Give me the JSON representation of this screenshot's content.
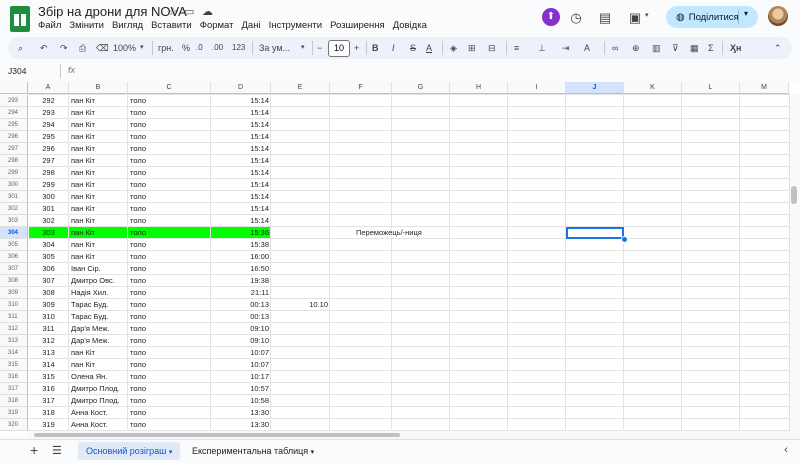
{
  "title": "Збір на дрони для NOVA",
  "menu": [
    "Файл",
    "Змінити",
    "Вигляд",
    "Вставити",
    "Формат",
    "Дані",
    "Інструменти",
    "Розширення",
    "Довідка"
  ],
  "share_label": "Поділитися",
  "toolbar": {
    "zoom": "100%",
    "currency": "грн.",
    "percent": "%",
    "dec_decrease": ".0",
    "dec_increase": ".00",
    "number_format": "123",
    "font": "За ум...",
    "font_size": "10"
  },
  "name_box": "J304",
  "fx_label": "fx",
  "formula_value": "",
  "columns": [
    "A",
    "B",
    "C",
    "D",
    "E",
    "F",
    "G",
    "H",
    "I",
    "J",
    "K",
    "L",
    "M"
  ],
  "selected_column": "J",
  "selected_row": "304",
  "rows": [
    {
      "n": "293",
      "a": "292",
      "b": "пан Кіт",
      "c": "толо",
      "d": "15:14",
      "e": "",
      "f": ""
    },
    {
      "n": "294",
      "a": "293",
      "b": "пан Кіт",
      "c": "толо",
      "d": "15:14",
      "e": "",
      "f": ""
    },
    {
      "n": "295",
      "a": "294",
      "b": "пан Кіт",
      "c": "толо",
      "d": "15:14",
      "e": "",
      "f": ""
    },
    {
      "n": "296",
      "a": "295",
      "b": "пан Кіт",
      "c": "толо",
      "d": "15:14",
      "e": "",
      "f": ""
    },
    {
      "n": "297",
      "a": "296",
      "b": "пан Кіт",
      "c": "толо",
      "d": "15:14",
      "e": "",
      "f": ""
    },
    {
      "n": "298",
      "a": "297",
      "b": "пан Кіт",
      "c": "толо",
      "d": "15:14",
      "e": "",
      "f": ""
    },
    {
      "n": "299",
      "a": "298",
      "b": "пан Кіт",
      "c": "толо",
      "d": "15:14",
      "e": "",
      "f": ""
    },
    {
      "n": "300",
      "a": "299",
      "b": "пан Кіт",
      "c": "толо",
      "d": "15:14",
      "e": "",
      "f": ""
    },
    {
      "n": "301",
      "a": "300",
      "b": "пан Кіт",
      "c": "толо",
      "d": "15:14",
      "e": "",
      "f": ""
    },
    {
      "n": "302",
      "a": "301",
      "b": "пан Кіт",
      "c": "толо",
      "d": "15:14",
      "e": "",
      "f": ""
    },
    {
      "n": "303",
      "a": "302",
      "b": "пан Кіт",
      "c": "толо",
      "d": "15:14",
      "e": "",
      "f": ""
    },
    {
      "n": "304",
      "a": "303",
      "b": "пан Кіт",
      "c": "толо",
      "d": "15:36",
      "e": "",
      "f": "Переможець/-ниця"
    },
    {
      "n": "305",
      "a": "304",
      "b": "пан Кіт",
      "c": "толо",
      "d": "15:38",
      "e": "",
      "f": ""
    },
    {
      "n": "306",
      "a": "305",
      "b": "пан Кіт",
      "c": "толо",
      "d": "16:00",
      "e": "",
      "f": ""
    },
    {
      "n": "307",
      "a": "306",
      "b": "Іван Сір.",
      "c": "толо",
      "d": "16:50",
      "e": "",
      "f": ""
    },
    {
      "n": "308",
      "a": "307",
      "b": "Дмитро Овс.",
      "c": "толо",
      "d": "19:38",
      "e": "",
      "f": ""
    },
    {
      "n": "309",
      "a": "308",
      "b": "Надія Хил.",
      "c": "толо",
      "d": "21:11",
      "e": "",
      "f": ""
    },
    {
      "n": "310",
      "a": "309",
      "b": "Тарас Буд.",
      "c": "толо",
      "d": "00:13",
      "e": "10.10",
      "f": ""
    },
    {
      "n": "311",
      "a": "310",
      "b": "Тарас Буд.",
      "c": "толо",
      "d": "00:13",
      "e": "",
      "f": ""
    },
    {
      "n": "312",
      "a": "311",
      "b": "Дар'я Меж.",
      "c": "толо",
      "d": "09:10",
      "e": "",
      "f": ""
    },
    {
      "n": "313",
      "a": "312",
      "b": "Дар'я Меж.",
      "c": "толо",
      "d": "09:10",
      "e": "",
      "f": ""
    },
    {
      "n": "314",
      "a": "313",
      "b": "пан Кіт",
      "c": "толо",
      "d": "10:07",
      "e": "",
      "f": ""
    },
    {
      "n": "315",
      "a": "314",
      "b": "пан Кіт",
      "c": "толо",
      "d": "10:07",
      "e": "",
      "f": ""
    },
    {
      "n": "316",
      "a": "315",
      "b": "Олена Ян.",
      "c": "толо",
      "d": "10:17",
      "e": "",
      "f": ""
    },
    {
      "n": "317",
      "a": "316",
      "b": "Дмитро Плод.",
      "c": "толо",
      "d": "10:57",
      "e": "",
      "f": ""
    },
    {
      "n": "318",
      "a": "317",
      "b": "Дмитро Плод.",
      "c": "толо",
      "d": "10:58",
      "e": "",
      "f": ""
    },
    {
      "n": "319",
      "a": "318",
      "b": "Анна Кост.",
      "c": "толо",
      "d": "13:30",
      "e": "",
      "f": ""
    },
    {
      "n": "320",
      "a": "319",
      "b": "Анна Кост.",
      "c": "толо",
      "d": "13:30",
      "e": "",
      "f": ""
    }
  ],
  "highlight_color": "#00ff00",
  "accent_color": "#1a73e8",
  "sheets": [
    {
      "label": "Основний розіграш",
      "active": true
    },
    {
      "label": "Експериментальна таблиця",
      "active": false
    }
  ],
  "icons": [
    "sheets-logo-icon",
    "star-icon",
    "move-folder-icon",
    "cloud-status-icon",
    "extension-icon",
    "history-icon",
    "comments-icon",
    "meet-icon",
    "globe-icon",
    "chevron-down-icon",
    "avatar",
    "search-icon",
    "undo-icon",
    "redo-icon",
    "print-icon",
    "paint-format-icon",
    "bold-icon",
    "italic-icon",
    "strikethrough-icon",
    "text-color-icon",
    "fill-color-icon",
    "borders-icon",
    "merge-icon",
    "align-icon",
    "valign-icon",
    "wrap-icon",
    "rotate-icon",
    "link-icon",
    "comment-icon",
    "chart-icon",
    "filter-icon",
    "filter-views-icon",
    "functions-icon",
    "input-tools-icon",
    "collapse-icon",
    "add-sheet-icon",
    "all-sheets-icon",
    "explore-icon"
  ]
}
